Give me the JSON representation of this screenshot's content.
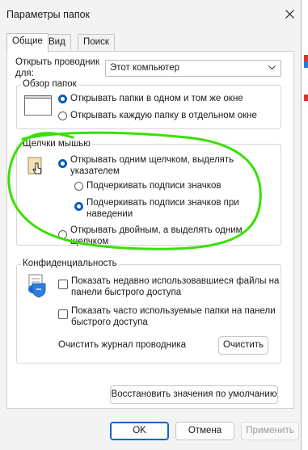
{
  "window": {
    "title": "Параметры папок"
  },
  "tabs": [
    {
      "label": "Общие",
      "active": true
    },
    {
      "label": "Вид",
      "active": false
    },
    {
      "label": "Поиск",
      "active": false
    }
  ],
  "open_explorer": {
    "label_line1": "Открыть проводник",
    "label_line2": "для:",
    "value": "Этот компьютер"
  },
  "browse_folders": {
    "title": "Обзор папок",
    "options": [
      {
        "label": "Открывать папки в одном и том же окне",
        "selected": true
      },
      {
        "label": "Открывать каждую папку в отдельном окне",
        "selected": false
      }
    ]
  },
  "click_items": {
    "title": "Щелчки мышью",
    "single_click_line1": "Открывать одним щелчком, выделять",
    "single_click_line2": "указателем",
    "underline_always": "Подчеркивать подписи значков",
    "underline_hover_line1": "Подчеркивать подписи значков при",
    "underline_hover_line2": "наведении",
    "double_click_line1": "Открывать двойным, а выделять одним",
    "double_click_line2": "щелчком"
  },
  "privacy": {
    "title": "Конфиденциальность",
    "recent_files_line1": "Показать недавно использовавшиеся файлы на",
    "recent_files_line2": "панели быстрого доступа",
    "frequent_folders_line1": "Показать часто используемые папки на панели",
    "frequent_folders_line2": "быстрого доступа",
    "clear_label": "Очистить журнал проводника",
    "clear_button": "Очистить"
  },
  "restore_defaults": "Восстановить значения по умолчанию",
  "footer": {
    "ok": "OK",
    "cancel": "Отмена",
    "apply": "Применить"
  },
  "colors": {
    "accent": "#0a5db8",
    "annotation": "#39e000"
  }
}
